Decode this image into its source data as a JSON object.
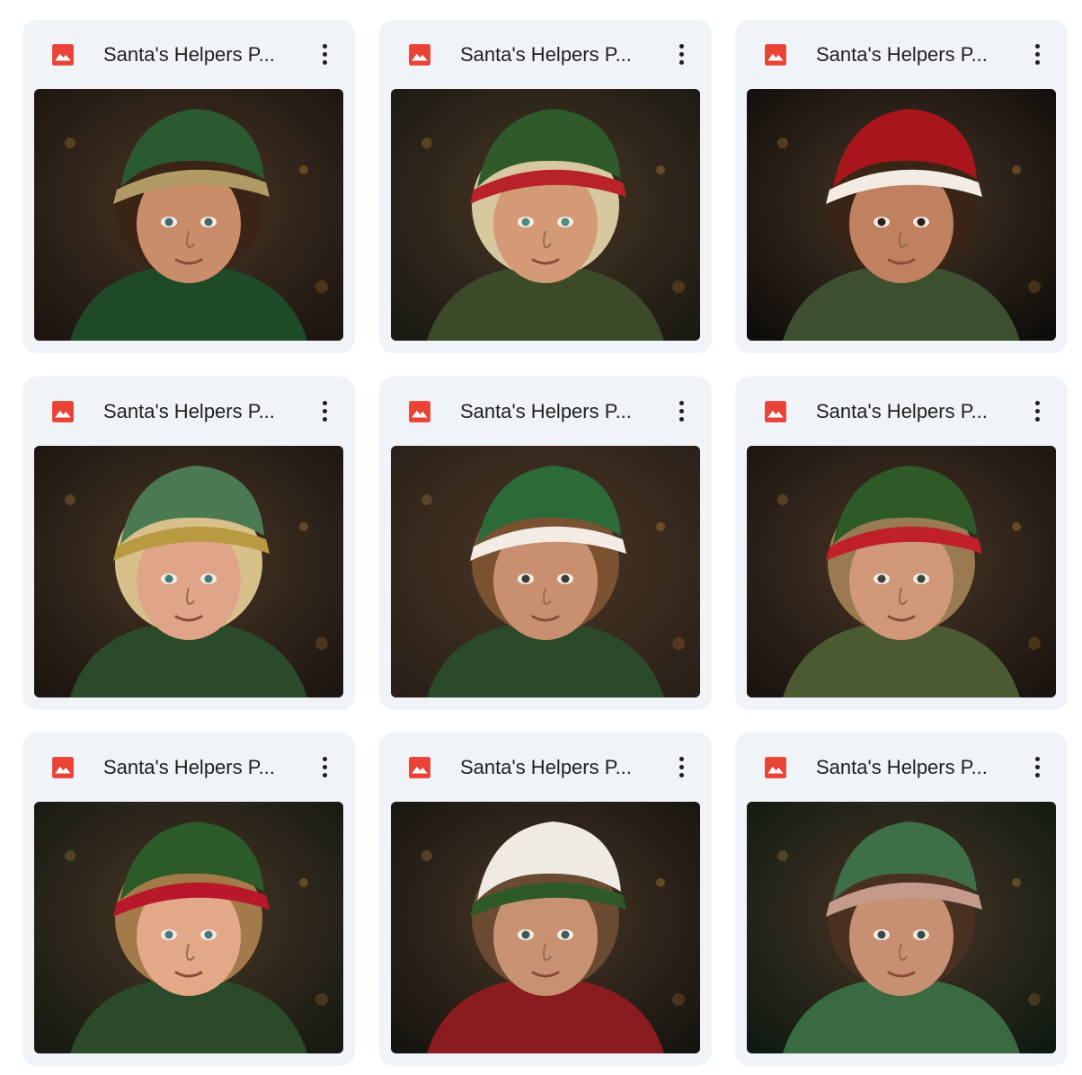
{
  "files": [
    {
      "title": "Santa's Helpers P...",
      "icon": "image-file-icon",
      "icon_color": "#ea4335",
      "thumbnail": {
        "subject": "boy-green-velvet-hat",
        "bg": "#1c1510",
        "hat": "#2c5a30",
        "hat_trim": "#b29a66",
        "hair": "#3a2416",
        "skin": "#c98d6a",
        "coat": "#1f4a28",
        "eyes": "#3d6a70"
      }
    },
    {
      "title": "Santa's Helpers P...",
      "icon": "image-file-icon",
      "icon_color": "#ea4335",
      "thumbnail": {
        "subject": "blond-boy-holly-wreath",
        "bg": "#1a1a12",
        "hat": "#2f5a2a",
        "hat_trim": "#b8232a",
        "hair": "#d8c8a0",
        "skin": "#d49a76",
        "coat": "#3c4a2a",
        "eyes": "#4d8a80"
      }
    },
    {
      "title": "Santa's Helpers P...",
      "icon": "image-file-icon",
      "icon_color": "#ea4335",
      "thumbnail": {
        "subject": "boy-red-santa-hat",
        "bg": "#0f0d0b",
        "hat": "#a8161c",
        "hat_trim": "#f2ece4",
        "hair": "#3a2416",
        "skin": "#c08160",
        "coat": "#3c5030",
        "eyes": "#2a2018"
      }
    },
    {
      "title": "Santa's Helpers P...",
      "icon": "image-file-icon",
      "icon_color": "#ea4335",
      "thumbnail": {
        "subject": "blond-boy-green-elf-hood",
        "bg": "#1c1610",
        "hat": "#4b7a52",
        "hat_trim": "#b89a40",
        "hair": "#d8c08a",
        "skin": "#e0a488",
        "coat": "#2b4a2a",
        "eyes": "#3f7d7a"
      }
    },
    {
      "title": "Santa's Helpers P...",
      "icon": "image-file-icon",
      "icon_color": "#ea4335",
      "thumbnail": {
        "subject": "boy-green-santa-hat",
        "bg": "#2a2018",
        "hat": "#2c6a38",
        "hat_trim": "#f2ece4",
        "hair": "#7a5232",
        "skin": "#c89070",
        "coat": "#2a4a2a",
        "eyes": "#3a3a38"
      }
    },
    {
      "title": "Santa's Helpers P...",
      "icon": "image-file-icon",
      "icon_color": "#ea4335",
      "thumbnail": {
        "subject": "boy-holly-crown-green-hood",
        "bg": "#1a1410",
        "hat": "#2e5a28",
        "hat_trim": "#c0202a",
        "hair": "#9a7a50",
        "skin": "#d09878",
        "coat": "#4b5a30",
        "eyes": "#3a4438"
      }
    },
    {
      "title": "Santa's Helpers P...",
      "icon": "image-file-icon",
      "icon_color": "#ea4335",
      "thumbnail": {
        "subject": "girl-holly-berry-crown",
        "bg": "#161a12",
        "hat": "#2c5a28",
        "hat_trim": "#b8182a",
        "hair": "#a47a4a",
        "skin": "#e2a888",
        "coat": "#2a4a2a",
        "eyes": "#4a7a78"
      }
    },
    {
      "title": "Santa's Helpers P...",
      "icon": "image-file-icon",
      "icon_color": "#ea4335",
      "thumbnail": {
        "subject": "boy-white-fur-hat-holly",
        "bg": "#161410",
        "hat": "#f0ebe2",
        "hat_trim": "#2e5a28",
        "hair": "#6a4a30",
        "skin": "#c89272",
        "coat": "#8a1c20",
        "eyes": "#3d5a5a"
      }
    },
    {
      "title": "Santa's Helpers P...",
      "icon": "image-file-icon",
      "icon_color": "#ea4335",
      "thumbnail": {
        "subject": "child-embroidered-green-hood",
        "bg": "#101a12",
        "hat": "#3e7048",
        "hat_trim": "#c49a8a",
        "hair": "#4a3020",
        "skin": "#c89072",
        "coat": "#3a6a40",
        "eyes": "#3a4a48"
      }
    }
  ]
}
